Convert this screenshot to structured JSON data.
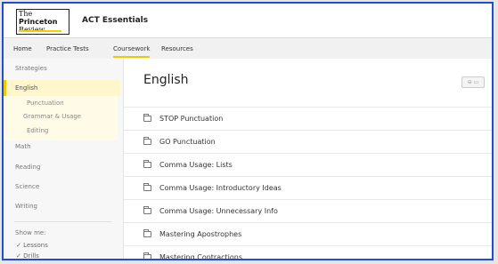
{
  "brand": {
    "line1": "The",
    "line2": "Princeton",
    "line3": "Review"
  },
  "app": {
    "title": "ACT Essentials"
  },
  "nav": {
    "items": [
      "Home",
      "Practice Tests",
      "Coursework",
      "Resources"
    ],
    "active_index": 2
  },
  "sidebar": {
    "heading": "Strategies",
    "active": "English",
    "subitems": [
      "Punctuation",
      "Grammar & Usage",
      "Editing"
    ],
    "items": [
      "Math",
      "Reading",
      "Science",
      "Writing"
    ],
    "show_me_label": "Show me:",
    "filters": [
      "Lessons",
      "Drills"
    ]
  },
  "main": {
    "title": "English",
    "rows": [
      "STOP Punctuation",
      "GO Punctuation",
      "Comma Usage: Lists",
      "Comma Usage: Introductory Ideas",
      "Comma Usage: Unnecessary Info",
      "Mastering Apostrophes",
      "Mastering Contractions"
    ]
  },
  "colors": {
    "frame": "#1f4fd0",
    "accent": "#f0c800",
    "highlight": "#fff6cc"
  }
}
